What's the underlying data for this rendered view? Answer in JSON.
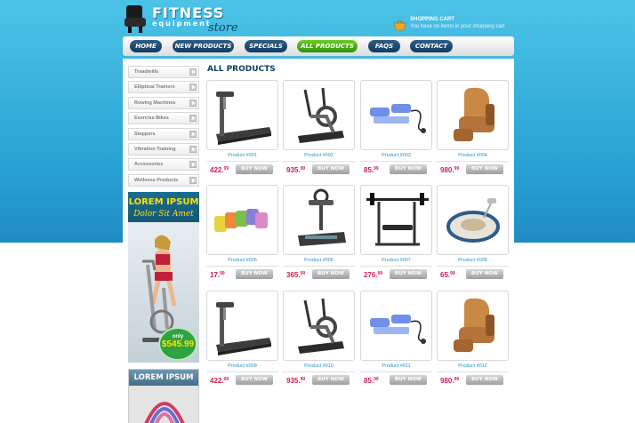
{
  "header": {
    "logo_title": "FITNESS",
    "logo_sub": "equipment",
    "logo_store": "store",
    "cart_title": "SHOPPING CART",
    "cart_message": "You have no items in your shopping cart"
  },
  "nav": {
    "items": [
      {
        "label": "HOME",
        "active": false
      },
      {
        "label": "NEW PRODUCTS",
        "active": false
      },
      {
        "label": "SPECIALS",
        "active": false
      },
      {
        "label": "ALL PRODUCTS",
        "active": true
      },
      {
        "label": "FAQS",
        "active": false
      },
      {
        "label": "CONTACT",
        "active": false
      }
    ]
  },
  "sidebar": {
    "categories": [
      "Treadmills",
      "Elliptical Trainers",
      "Rowing Machines",
      "Exercise Bikes",
      "Steppers",
      "Vibration Training",
      "Accessories",
      "Wellness Products"
    ],
    "ad1": {
      "title": "LOREM IPSUM",
      "subtitle": "Dolor Sit Amet",
      "only": "only",
      "price": "$545.99"
    },
    "ad2": {
      "title": "LOREM IPSUM"
    }
  },
  "content": {
    "title": "ALL PRODUCTS",
    "buy_label": "BUY NOW",
    "products": [
      {
        "name": "Product #001",
        "price_int": "422.",
        "price_dec": "99",
        "icon": "treadmill-icon"
      },
      {
        "name": "Product #002",
        "price_int": "935.",
        "price_dec": "99",
        "icon": "elliptical-icon"
      },
      {
        "name": "Product #003",
        "price_int": "85.",
        "price_dec": "99",
        "icon": "stepper-icon"
      },
      {
        "name": "Product #004",
        "price_int": "980.",
        "price_dec": "99",
        "icon": "massage-chair-icon"
      },
      {
        "name": "Product #005",
        "price_int": "17.",
        "price_dec": "99",
        "icon": "dumbbells-icon"
      },
      {
        "name": "Product #006",
        "price_int": "365.",
        "price_dec": "99",
        "icon": "vibration-platform-icon"
      },
      {
        "name": "Product #007",
        "price_int": "276.",
        "price_dec": "99",
        "icon": "weight-bench-icon"
      },
      {
        "name": "Product #008",
        "price_int": "65.",
        "price_dec": "99",
        "icon": "foot-massager-icon"
      },
      {
        "name": "Product #009",
        "price_int": "422.",
        "price_dec": "99",
        "icon": "treadmill-icon"
      },
      {
        "name": "Product #010",
        "price_int": "935.",
        "price_dec": "99",
        "icon": "elliptical-icon"
      },
      {
        "name": "Product #011",
        "price_int": "85.",
        "price_dec": "99",
        "icon": "stepper-icon"
      },
      {
        "name": "Product #012",
        "price_int": "980.",
        "price_dec": "99",
        "icon": "massage-chair-icon"
      }
    ]
  }
}
